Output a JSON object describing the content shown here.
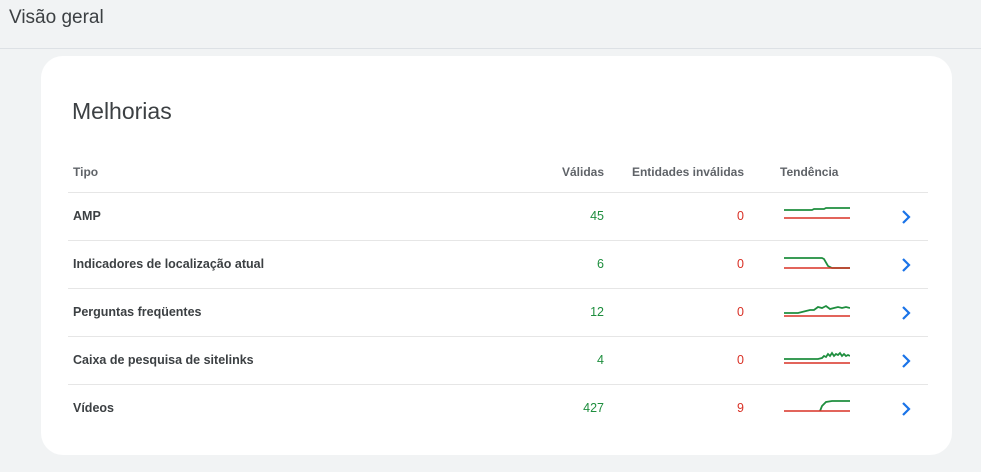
{
  "page_title": "Visão geral",
  "card": {
    "title": "Melhorias",
    "columns": {
      "tipo": "Tipo",
      "validas": "Válidas",
      "invalidas": "Entidades inválidas",
      "tendencia": "Tendência"
    },
    "rows": [
      {
        "tipo": "AMP",
        "validas": "45",
        "invalidas": "0",
        "trend": "amp"
      },
      {
        "tipo": "Indicadores de localização atual",
        "validas": "6",
        "invalidas": "0",
        "trend": "breadcrumb"
      },
      {
        "tipo": "Perguntas freqüentes",
        "validas": "12",
        "invalidas": "0",
        "trend": "faq"
      },
      {
        "tipo": "Caixa de pesquisa de sitelinks",
        "validas": "4",
        "invalidas": "0",
        "trend": "sitelinks"
      },
      {
        "tipo": "Vídeos",
        "validas": "427",
        "invalidas": "9",
        "trend": "videos"
      }
    ]
  },
  "colors": {
    "valid": "#1e8e3e",
    "invalid": "#d93025",
    "chevron": "#1a73e8"
  },
  "icons": {
    "row_action": "chevron-right-icon"
  }
}
